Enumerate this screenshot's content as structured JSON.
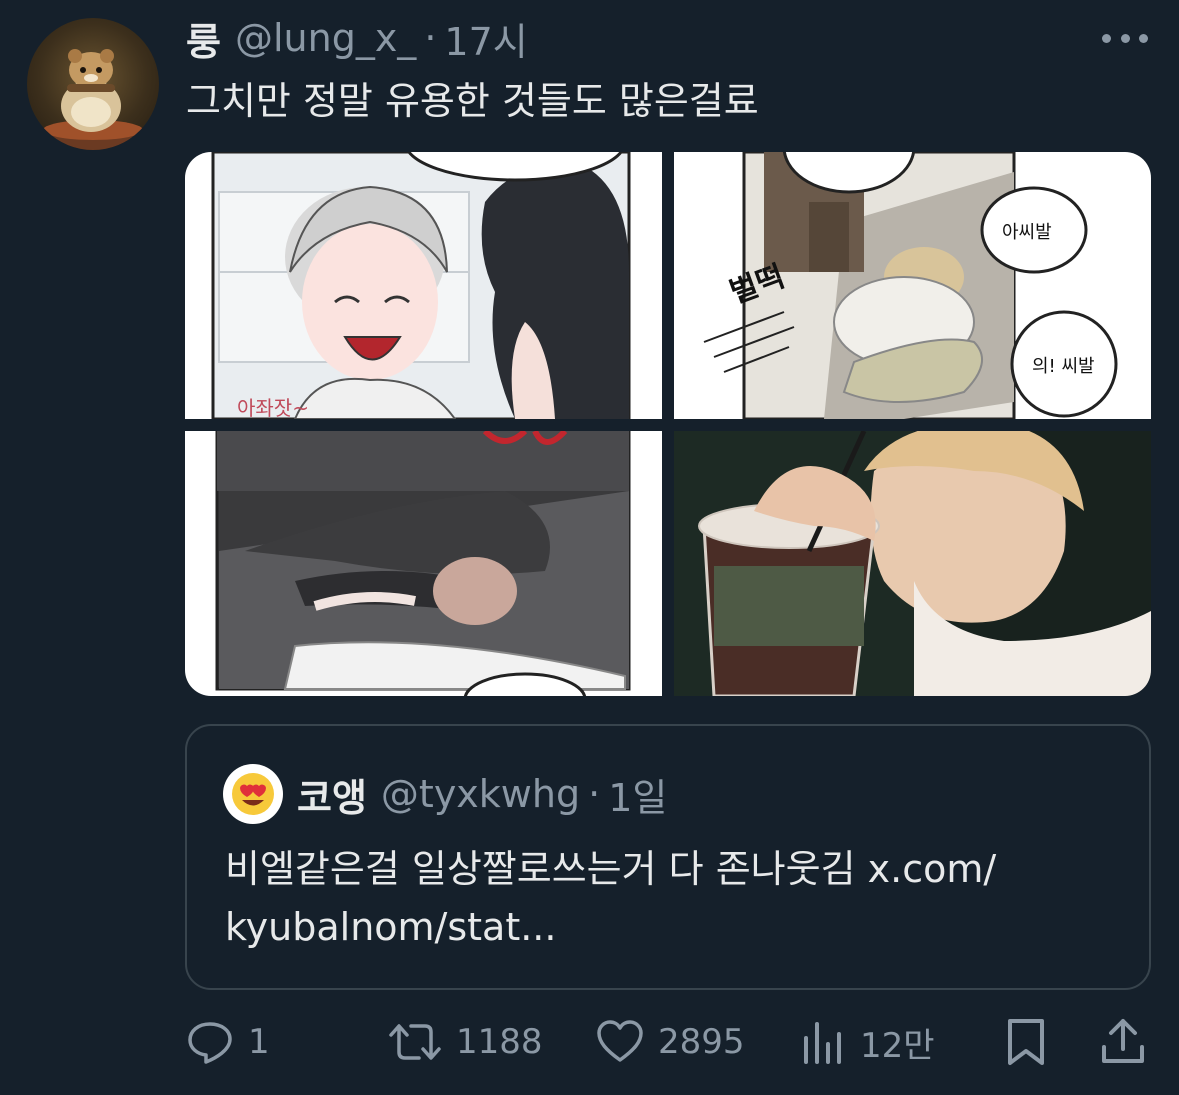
{
  "tweet": {
    "display_name": "룽",
    "handle": "@lung_x_",
    "separator": "·",
    "time": "17시",
    "text": "그치만 정말 유용한 것들도 많은걸료",
    "avatar_icon": "hamster-avatar"
  },
  "media": {
    "panels": [
      {
        "name": "comic-panel-1",
        "text": "아좌잣~"
      },
      {
        "name": "comic-panel-2",
        "sfx": "벌떡",
        "bubble_1": "아씨발",
        "bubble_2": "의! 씨발"
      },
      {
        "name": "comic-panel-3",
        "text": ""
      },
      {
        "name": "comic-panel-4",
        "text": ""
      }
    ]
  },
  "quote": {
    "avatar_emoji": "😍",
    "display_name": "코앵",
    "handle": "@tyxkwhg",
    "separator": "·",
    "time": "1일",
    "text_line1": "비엘같은걸 일상짤로쓰는거 다 존나웃김 x.com/",
    "text_line2": "kyubalnom/stat..."
  },
  "actions": {
    "replies": "1",
    "retweets": "1188",
    "likes": "2895",
    "views": "12만"
  },
  "colors": {
    "background": "#15202b",
    "text": "#e7e9ea",
    "secondary": "#8b98a5",
    "border": "#38444d"
  }
}
